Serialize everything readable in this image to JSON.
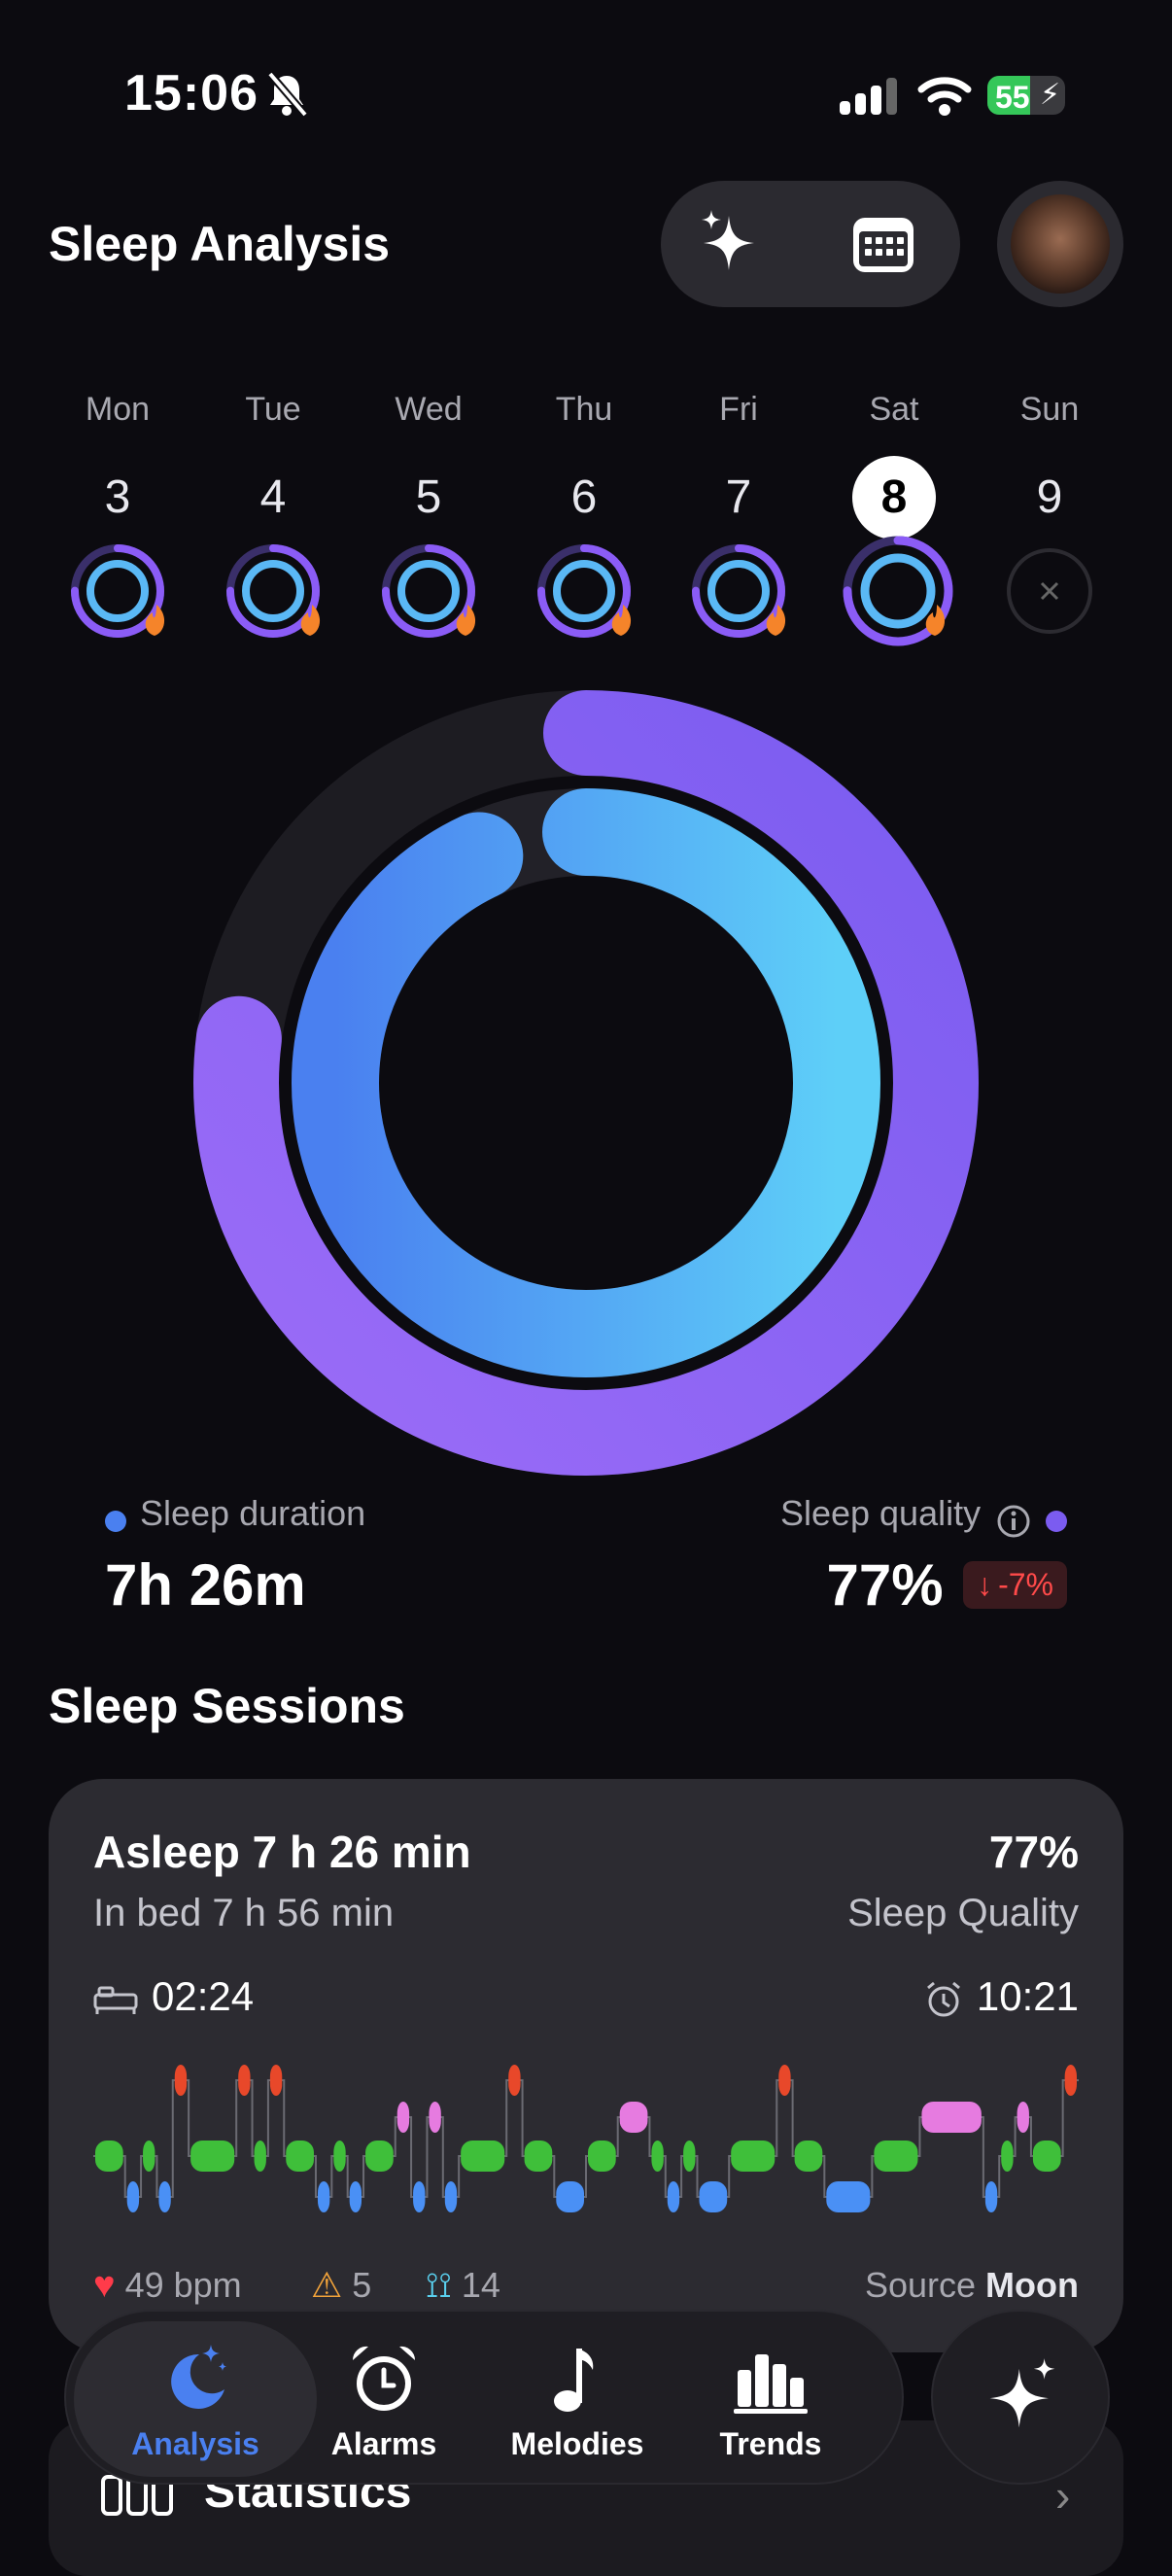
{
  "status_bar": {
    "time": "15:06",
    "battery": "55"
  },
  "header": {
    "title": "Sleep Analysis"
  },
  "week": [
    {
      "day": "Mon",
      "date": "3",
      "state": "done"
    },
    {
      "day": "Tue",
      "date": "4",
      "state": "done"
    },
    {
      "day": "Wed",
      "date": "5",
      "state": "done"
    },
    {
      "day": "Thu",
      "date": "6",
      "state": "done"
    },
    {
      "day": "Fri",
      "date": "7",
      "state": "done"
    },
    {
      "day": "Sat",
      "date": "8",
      "state": "selected"
    },
    {
      "day": "Sun",
      "date": "9",
      "state": "missing"
    }
  ],
  "rings": {
    "duration_fraction": 0.93,
    "quality_fraction": 0.77,
    "duration_color": "#4a90f5",
    "quality_color": "#8b5cf6"
  },
  "metrics": {
    "duration_label": "Sleep duration",
    "duration_value": "7h 26m",
    "quality_label": "Sleep quality",
    "quality_value": "77%",
    "quality_change": "-7%"
  },
  "sessions": {
    "title": "Sleep Sessions",
    "asleep": "Asleep 7 h 26 min",
    "quality_pct": "77%",
    "in_bed": "In bed 7 h 56 min",
    "quality_label": "Sleep Quality",
    "bed_time": "02:24",
    "wake_time": "10:21",
    "heart_rate": "49 bpm",
    "warnings": "5",
    "breathing": "14",
    "source_label": "Source",
    "source_value": "Moon",
    "hypnogram": [
      2,
      2,
      3,
      2,
      3,
      0,
      2,
      2,
      2,
      0,
      2,
      0,
      2,
      2,
      3,
      2,
      3,
      2,
      2,
      1,
      3,
      1,
      3,
      2,
      2,
      2,
      0,
      2,
      2,
      3,
      3,
      2,
      2,
      1,
      1,
      2,
      3,
      2,
      3,
      3,
      2,
      2,
      2,
      0,
      2,
      2,
      3,
      3,
      3,
      2,
      2,
      2,
      1,
      1,
      1,
      1,
      3,
      2,
      1,
      2,
      2,
      0
    ]
  },
  "statistics": {
    "label": "Statistics"
  },
  "tabs": [
    {
      "label": "Analysis",
      "icon": "moon-icon",
      "active": true
    },
    {
      "label": "Alarms",
      "icon": "alarm-icon",
      "active": false
    },
    {
      "label": "Melodies",
      "icon": "music-note-icon",
      "active": false
    },
    {
      "label": "Trends",
      "icon": "bar-chart-icon",
      "active": false
    }
  ],
  "colors": {
    "awake": "#e8482a",
    "rem": "#e67be0",
    "light": "#3fbf3a",
    "deep": "#4a90f5",
    "accent": "#4a90f5"
  }
}
